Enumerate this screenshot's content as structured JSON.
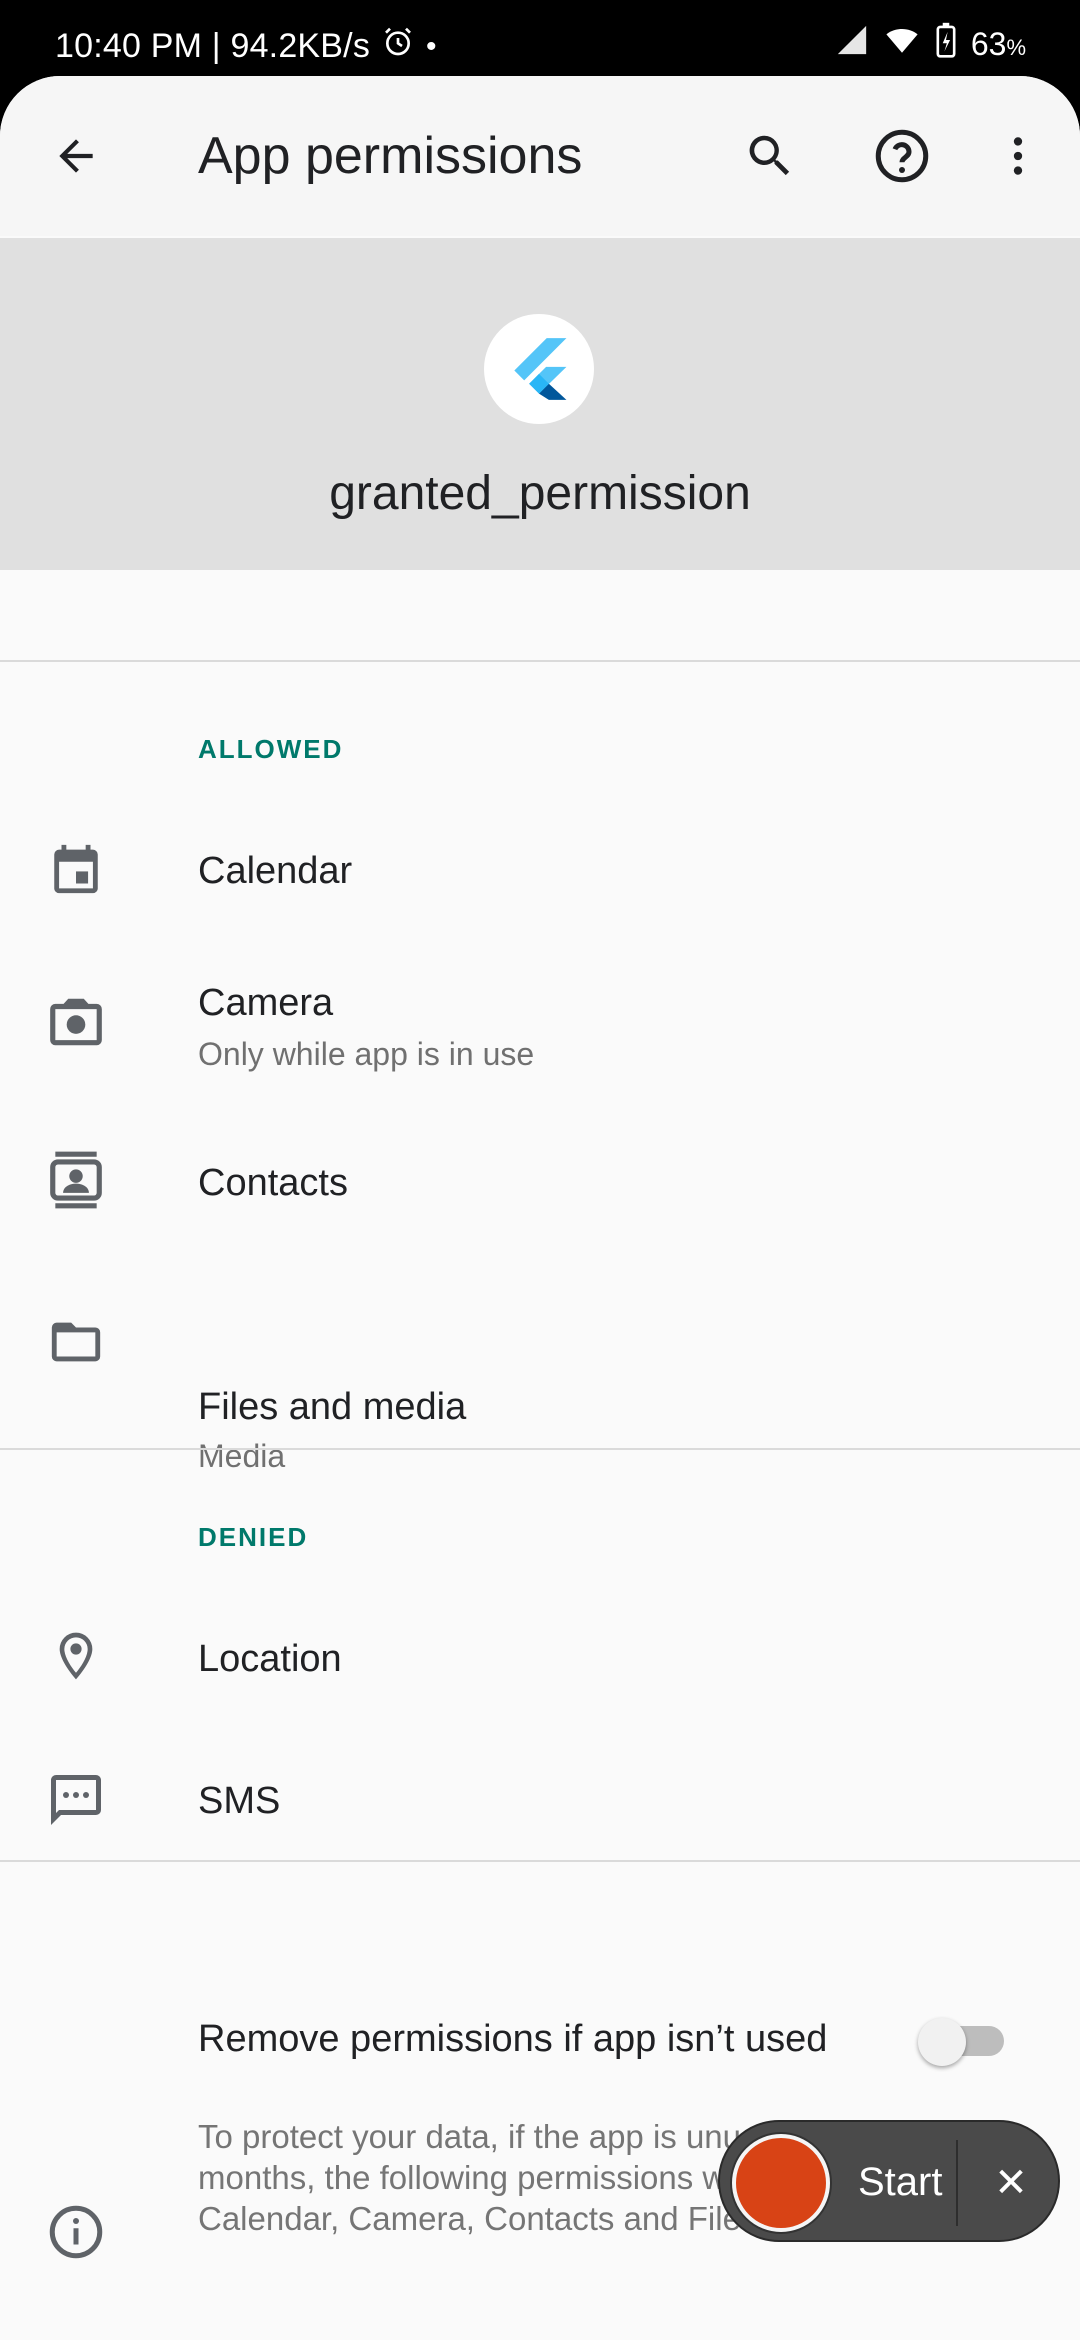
{
  "status_bar": {
    "time_speed": "10:40 PM | 94.2KB/s",
    "battery": "63",
    "battery_unit": "%"
  },
  "appbar": {
    "title": "App permissions"
  },
  "app": {
    "name": "granted_permission"
  },
  "allowed": {
    "label": "ALLOWED",
    "items": [
      {
        "label": "Calendar",
        "sub": "",
        "icon": "calendar-icon"
      },
      {
        "label": "Camera",
        "sub": "Only while app is in use",
        "icon": "camera-icon"
      },
      {
        "label": "Contacts",
        "sub": "",
        "icon": "contacts-icon"
      },
      {
        "label": "Files and media",
        "sub": "Media",
        "icon": "folder-icon"
      }
    ]
  },
  "denied": {
    "label": "DENIED",
    "items": [
      {
        "label": "Location",
        "sub": "",
        "icon": "location-icon"
      },
      {
        "label": "SMS",
        "sub": "",
        "icon": "sms-icon"
      }
    ]
  },
  "remove_permissions": {
    "label": "Remove permissions if app isn’t used",
    "enabled": false
  },
  "info": {
    "text": "To protect your data, if the app is unused for a few months, the following permissions will be removed: Calendar, Camera, Contacts and Files and media"
  },
  "recorder": {
    "start_label": "Start",
    "close_glyph": "✕"
  },
  "colors": {
    "accent": "#00796b",
    "record": "#d84315"
  }
}
